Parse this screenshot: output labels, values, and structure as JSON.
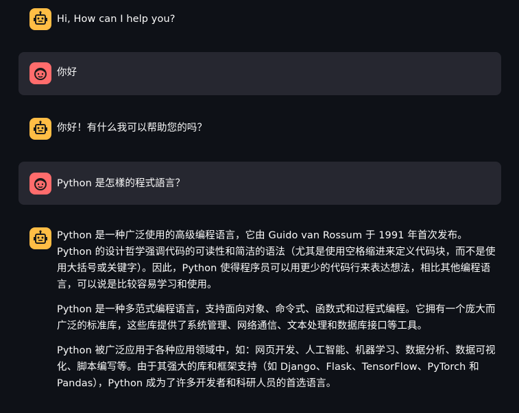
{
  "messages": [
    {
      "role": "assistant",
      "icon": "bot-icon",
      "paragraphs": [
        "Hi, How can I help you?"
      ]
    },
    {
      "role": "user",
      "icon": "user-face-icon",
      "paragraphs": [
        "你好"
      ]
    },
    {
      "role": "assistant",
      "icon": "bot-icon",
      "paragraphs": [
        "你好！有什么我可以帮助您的吗？"
      ]
    },
    {
      "role": "user",
      "icon": "user-face-icon",
      "paragraphs": [
        "Python 是怎樣的程式語言？"
      ]
    },
    {
      "role": "assistant",
      "icon": "bot-icon",
      "paragraphs": [
        "Python 是一种广泛使用的高级编程语言，它由 Guido van Rossum 于 1991 年首次发布。Python 的设计哲学强调代码的可读性和简洁的语法（尤其是使用空格缩进来定义代码块，而不是使用大括号或关键字）。因此，Python 使得程序员可以用更少的代码行来表达想法，相比其他编程语言，可以说是比较容易学习和使用。",
        "Python 是一种多范式编程语言，支持面向对象、命令式、函数式和过程式编程。它拥有一个庞大而广泛的标准库，这些库提供了系统管理、网络通信、文本处理和数据库接口等工具。",
        "Python 被广泛应用于各种应用领域中，如：网页开发、人工智能、机器学习、数据分析、数据可视化、脚本编写等。由于其强大的库和框架支持（如 Django、Flask、TensorFlow、PyTorch 和 Pandas），Python 成为了许多开发者和科研人员的首选语言。"
      ]
    }
  ],
  "colors": {
    "background": "#0e1117",
    "user_bubble": "#262730",
    "assistant_avatar": "#ffbd45",
    "user_avatar": "#ff6c6c",
    "text": "#fafafa"
  }
}
